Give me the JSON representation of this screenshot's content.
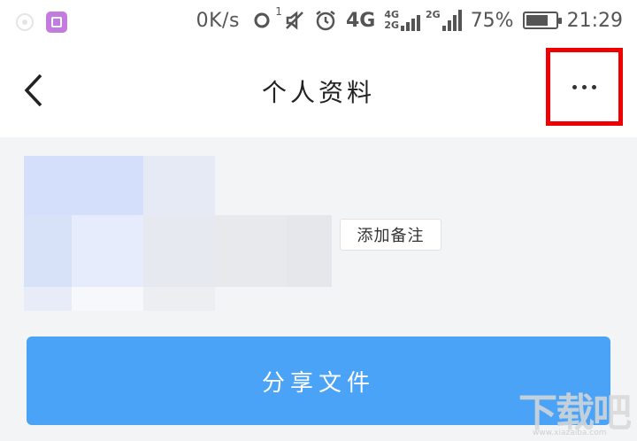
{
  "status_bar": {
    "network_speed": "0K/s",
    "hotspot_badge": "1",
    "network_type": "4G",
    "sim1_type": "4G",
    "sim2_type": "2G",
    "sim3_type": "2G",
    "battery_percent": "75%",
    "battery_level": 0.75,
    "time": "21:29",
    "icons": [
      "circle-status-icon",
      "gallery-app-icon",
      "hotspot-icon",
      "vibrate-off-icon",
      "alarm-icon",
      "signal-icon",
      "battery-icon"
    ]
  },
  "header": {
    "title": "个人资料",
    "back_icon": "chevron-left-icon",
    "more_icon": "more-horizontal-icon",
    "highlight_color": "#ee0000"
  },
  "profile": {
    "add_remark_label": "添加备注"
  },
  "actions": {
    "share_label": "分享文件",
    "share_color": "#4aa3f7"
  },
  "watermark": {
    "text": "下载吧",
    "url": "www.xiazaiba.com"
  }
}
